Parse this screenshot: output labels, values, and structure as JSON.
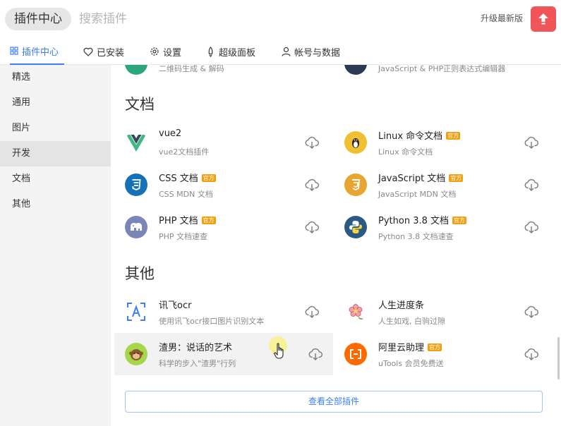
{
  "header": {
    "title": "插件中心",
    "search_placeholder": "搜索插件",
    "upgrade_label": "升级最新版",
    "upgrade_icon": "arrow-up-icon",
    "accent": "#f0555a"
  },
  "tabs": [
    {
      "label": "插件中心",
      "icon": "grid-icon",
      "active": true
    },
    {
      "label": "已安装",
      "icon": "heart-icon"
    },
    {
      "label": "设置",
      "icon": "gear-icon"
    },
    {
      "label": "超级面板",
      "icon": "rocket-icon"
    },
    {
      "label": "帐号与数据",
      "icon": "user-icon"
    }
  ],
  "sidebar": {
    "items": [
      {
        "label": "精选"
      },
      {
        "label": "通用"
      },
      {
        "label": "图片"
      },
      {
        "label": "开发",
        "active": true
      },
      {
        "label": "文档"
      },
      {
        "label": "其他"
      }
    ]
  },
  "partial_row": {
    "left_desc": "二维码生成 & 解码",
    "right_desc": "JavaScript & PHP正则表达式编辑器"
  },
  "sections": [
    {
      "title": "文档",
      "plugins": [
        {
          "name": "vue2",
          "desc": "vue2文档插件",
          "official": false,
          "icon": "vue-logo-icon"
        },
        {
          "name": "Linux 命令文档",
          "desc": "Linux 命令文档",
          "official": true,
          "icon": "linux-penguin-icon"
        },
        {
          "name": "CSS 文档",
          "desc": "CSS MDN 文档",
          "official": true,
          "icon": "css3-icon"
        },
        {
          "name": "JavaScript 文档",
          "desc": "JavaScript MDN 文档",
          "official": true,
          "icon": "javascript-icon"
        },
        {
          "name": "PHP 文档",
          "desc": "PHP 文档速查",
          "official": true,
          "icon": "php-elephant-icon"
        },
        {
          "name": "Python 3.8 文档",
          "desc": "Python 3.8 文档速查",
          "official": true,
          "icon": "python-icon"
        }
      ]
    },
    {
      "title": "其他",
      "plugins": [
        {
          "name": "讯飞ocr",
          "desc": "使用讯飞ocr接口图片识别文本",
          "official": false,
          "icon": "ocr-scan-icon"
        },
        {
          "name": "人生进度条",
          "desc": "人生如戏, 白驹过隙",
          "official": false,
          "icon": "flower-icon"
        },
        {
          "name": "渣男：说话的艺术",
          "desc": "科学的步入\"渣男\"行列",
          "official": false,
          "icon": "monkey-icon"
        },
        {
          "name": "阿里云助理",
          "desc": "uTools 会员免费送",
          "official": true,
          "icon": "aliyun-icon"
        }
      ]
    }
  ],
  "official_badge": "官方",
  "download_icon": "cloud-download-icon",
  "view_all_label": "查看全部插件"
}
